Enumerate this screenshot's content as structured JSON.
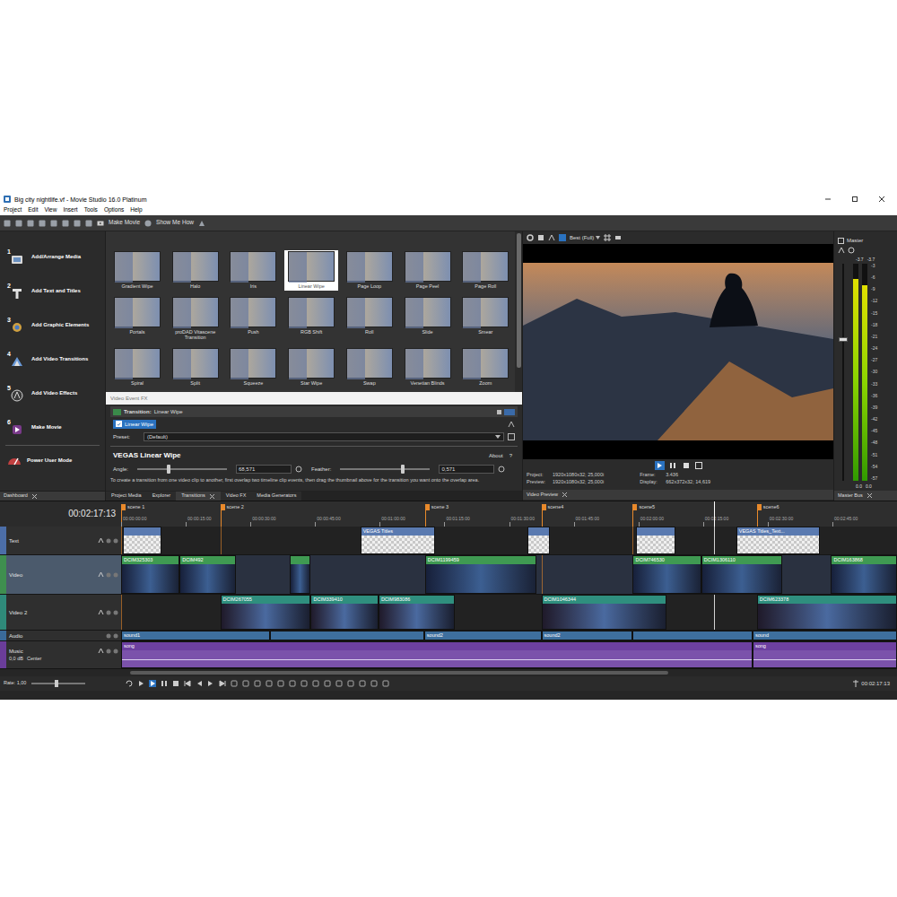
{
  "window": {
    "title": "Big city nightlife.vf - Movie Studio 16.0 Platinum"
  },
  "menu": [
    "Project",
    "Edit",
    "View",
    "Insert",
    "Tools",
    "Options",
    "Help"
  ],
  "toolbar": {
    "make_movie": "Make Movie",
    "show_me_how": "Show Me How"
  },
  "wizard": {
    "items": [
      {
        "step": "1",
        "label": "Add/Arrange Media"
      },
      {
        "step": "2",
        "label": "Add Text and Titles"
      },
      {
        "step": "3",
        "label": "Add Graphic Elements"
      },
      {
        "step": "4",
        "label": "Add Video Transitions"
      },
      {
        "step": "5",
        "label": "Add Video Effects"
      },
      {
        "step": "6",
        "label": "Make Movie"
      }
    ],
    "power_user": "Power User Mode",
    "tab": "Dashboard"
  },
  "transitions": {
    "items": [
      {
        "label": "Gradient Wipe",
        "selected": false
      },
      {
        "label": "Halo",
        "selected": false
      },
      {
        "label": "Iris",
        "selected": false
      },
      {
        "label": "Linear Wipe",
        "selected": true
      },
      {
        "label": "Page Loop",
        "selected": false
      },
      {
        "label": "Page Peel",
        "selected": false
      },
      {
        "label": "Page Roll",
        "selected": false
      },
      {
        "label": "Portals",
        "selected": false
      },
      {
        "label": "proDAD Vitascene Transition",
        "selected": false
      },
      {
        "label": "Push",
        "selected": false
      },
      {
        "label": "RGB Shift",
        "selected": false
      },
      {
        "label": "Roll",
        "selected": false
      },
      {
        "label": "Slide",
        "selected": false
      },
      {
        "label": "Smear",
        "selected": false
      },
      {
        "label": "Spiral",
        "selected": false
      },
      {
        "label": "Split",
        "selected": false
      },
      {
        "label": "Squeeze",
        "selected": false
      },
      {
        "label": "Star Wipe",
        "selected": false
      },
      {
        "label": "Swap",
        "selected": false
      },
      {
        "label": "Venetian Blinds",
        "selected": false
      },
      {
        "label": "Zoom",
        "selected": false
      }
    ]
  },
  "event_fx": {
    "header": "Video Event FX",
    "transition_label": "Transition:",
    "transition": "Linear Wipe",
    "chain": [
      {
        "label": "Linear Wipe",
        "checked": true
      }
    ],
    "preset_label": "Preset:",
    "preset": "(Default)",
    "plugin": "VEGAS Linear Wipe",
    "about": "About",
    "help": "?",
    "params": [
      {
        "label": "Angle:",
        "value": "68,571",
        "level": 0.35
      },
      {
        "label": "Feather:",
        "value": "0,571",
        "level": 0.7
      }
    ]
  },
  "hint": "To create a transition from one video clip to another, first overlap two timeline clip events, then drag the thumbnail above for the transition you want onto the overlap area.",
  "bottom_tabs": [
    {
      "label": "Project Media",
      "selected": false,
      "closable": false
    },
    {
      "label": "Explorer",
      "selected": false,
      "closable": false
    },
    {
      "label": "Transitions",
      "selected": true,
      "closable": true
    },
    {
      "label": "Video FX",
      "selected": false,
      "closable": false
    },
    {
      "label": "Media Generators",
      "selected": false,
      "closable": false
    }
  ],
  "preview": {
    "quality": "Best (Full)",
    "transport": [
      {
        "kind": "play",
        "selected": true
      },
      {
        "kind": "pause",
        "selected": false
      },
      {
        "kind": "stop",
        "selected": false
      }
    ],
    "info_left": [
      {
        "label": "Project:",
        "value": "1920x1080x32; 25,000i"
      },
      {
        "label": "Preview:",
        "value": "1920x1080x32; 25,000i"
      }
    ],
    "info_right": [
      {
        "label": "Frame:",
        "value": "3.436"
      },
      {
        "label": "Display:",
        "value": "662x372x32; 14,619"
      }
    ],
    "tab": "Video Preview"
  },
  "master": {
    "title": "Master",
    "peaks": [
      "-3.7",
      "-3.7"
    ],
    "levels": [
      0.93,
      0.9
    ],
    "fader": 0.66,
    "scale": [
      "-3",
      "-6",
      "-9",
      "-12",
      "-15",
      "-18",
      "-21",
      "-24",
      "-27",
      "-30",
      "-33",
      "-36",
      "-39",
      "-42",
      "-45",
      "-48",
      "-51",
      "-54",
      "-57"
    ],
    "bottom": [
      "0.0",
      "0.0"
    ],
    "tab": "Master Bus"
  },
  "timeline": {
    "timecode": "00:02:17:13",
    "duration": 180,
    "playhead": 137.5,
    "ruler": [
      {
        "label": "00:00:00:00",
        "time": 0
      },
      {
        "label": "00:00:15:00",
        "time": 15
      },
      {
        "label": "00:00:30:00",
        "time": 30
      },
      {
        "label": "00:00:45:00",
        "time": 45
      },
      {
        "label": "00:01:00:00",
        "time": 60
      },
      {
        "label": "00:01:15:00",
        "time": 75
      },
      {
        "label": "00:01:30:00",
        "time": 90
      },
      {
        "label": "00:01:45:00",
        "time": 105
      },
      {
        "label": "00:02:00:00",
        "time": 120
      },
      {
        "label": "00:02:15:00",
        "time": 135
      },
      {
        "label": "00:02:30:00",
        "time": 150
      },
      {
        "label": "00:02:45:00",
        "time": 165
      }
    ],
    "markers": [
      {
        "label": "scene 1",
        "time": 0
      },
      {
        "label": "scene 2",
        "time": 23
      },
      {
        "label": "scene 3",
        "time": 70.5
      },
      {
        "label": "scene4",
        "time": 97.5
      },
      {
        "label": "scene5",
        "time": 118.7
      },
      {
        "label": "scene6",
        "time": 147.5
      }
    ],
    "tracks": [
      {
        "name": "Text",
        "kind": "text",
        "selected": false,
        "clips": [
          {
            "start": 0.4,
            "end": 9.4
          },
          {
            "label": "VEGAS Titles",
            "start": 55.5,
            "end": 72.8
          },
          {
            "start": 94.2,
            "end": 99.4
          },
          {
            "start": 119.5,
            "end": 128.7
          },
          {
            "label": "VEGAS Titles_Text...",
            "start": 142.7,
            "end": 162.2
          }
        ]
      },
      {
        "name": "Video",
        "kind": "video",
        "selected": true,
        "clips": [
          {
            "label": "DCIM325303",
            "start": 0,
            "end": 13.6
          },
          {
            "label": "DCIM492",
            "start": 13.6,
            "end": 26.6
          },
          {
            "start": 39.1,
            "end": 44
          },
          {
            "label": "DCIM1199459",
            "start": 70.5,
            "end": 96.3
          },
          {
            "label": "DCIM746530",
            "start": 118.7,
            "end": 134.6
          },
          {
            "label": "DCIM1306110",
            "start": 134.6,
            "end": 153.4
          },
          {
            "label": "DCIM163868",
            "start": 164.7,
            "end": 180
          }
        ]
      },
      {
        "name": "Video 2",
        "kind": "video2",
        "selected": false,
        "clips": [
          {
            "label": "DCIM267055",
            "start": 23,
            "end": 44
          },
          {
            "label": "DCIM339410",
            "start": 44,
            "end": 59.7
          },
          {
            "label": "DCIM983086",
            "start": 59.7,
            "end": 77.4
          },
          {
            "label": "DCIM1046344",
            "start": 97.5,
            "end": 126.6
          },
          {
            "label": "DCIM623378",
            "start": 147.5,
            "end": 180
          }
        ]
      },
      {
        "name": "Audio",
        "kind": "audio",
        "selected": false,
        "clips": [
          {
            "label": "sound1",
            "start": 0,
            "end": 34.5
          },
          {
            "start": 34.5,
            "end": 70.3
          },
          {
            "label": "sound2",
            "start": 70.3,
            "end": 97.5
          },
          {
            "label": "sound2",
            "start": 97.5,
            "end": 118.7
          },
          {
            "start": 118.7,
            "end": 146.5
          },
          {
            "label": "sound",
            "start": 146.5,
            "end": 180
          }
        ]
      },
      {
        "name": "Music",
        "kind": "music",
        "selected": false,
        "volume": "0,0 dB",
        "pan": "Center",
        "clips": [
          {
            "label": "song",
            "start": 0,
            "end": 146.5
          },
          {
            "label": "song",
            "start": 146.5,
            "end": 180
          }
        ]
      }
    ],
    "rate": "Rate: 1,00",
    "end_time": "00:02:17:13"
  }
}
